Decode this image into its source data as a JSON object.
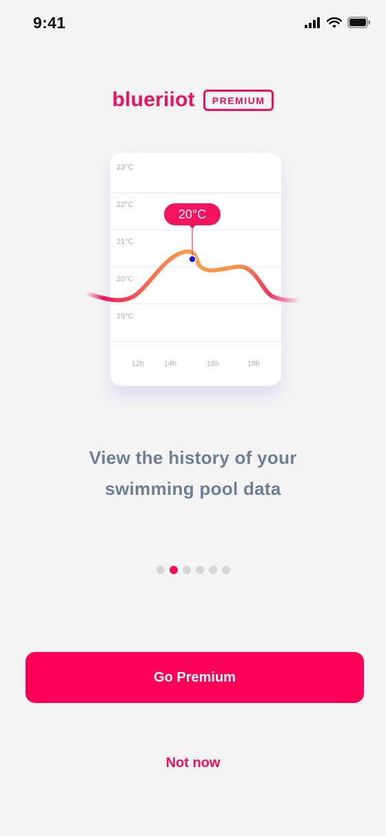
{
  "status_bar": {
    "time": "9:41"
  },
  "brand": {
    "name": "blueriiot",
    "badge": "PREMIUM"
  },
  "chart_data": {
    "type": "line",
    "x_tick_labels": [
      "12h",
      "14h",
      "16h",
      "19h"
    ],
    "y_tick_labels": [
      "23°C",
      "22°C",
      "21°C",
      "20°C",
      "19°C"
    ],
    "callout": "20°C",
    "colors": {
      "start": "#f50e5b",
      "mid": "#fba04a",
      "marker": "#1a1ae6"
    }
  },
  "headline": {
    "line1": "View the history of your",
    "line2": "swimming pool data"
  },
  "pager": {
    "count": 6,
    "active_index": 1
  },
  "buttons": {
    "primary": "Go Premium",
    "secondary": "Not now"
  }
}
